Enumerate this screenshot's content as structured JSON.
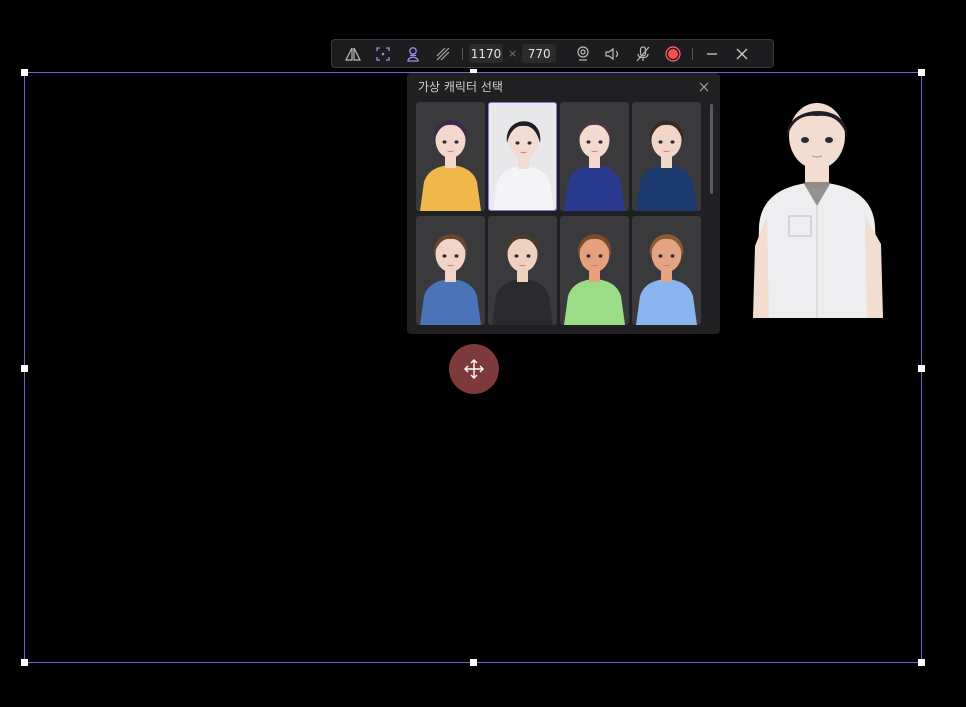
{
  "toolbar": {
    "width_value": "1170",
    "height_value": "770",
    "separator": "×",
    "record_color": "#ff4d4f",
    "icons": [
      "flip-icon",
      "region-icon",
      "virtual-character-icon",
      "hatch-icon",
      "webcam-icon",
      "speaker-icon",
      "microphone-icon",
      "record-icon",
      "minimize-icon",
      "close-icon"
    ]
  },
  "panel": {
    "title": "가상 캐릭터 선택",
    "characters": [
      {
        "id": "char-1",
        "hair": "#3b2a4a",
        "skin": "#f3d7cc",
        "top": "#f0b74a",
        "selected": false
      },
      {
        "id": "char-2",
        "hair": "#1e1e24",
        "skin": "#f2dcd2",
        "top": "#f4f4f6",
        "selected": true
      },
      {
        "id": "char-3",
        "hair": "#4a3644",
        "skin": "#f4d9cf",
        "top": "#2a3a8e",
        "selected": false
      },
      {
        "id": "char-4",
        "hair": "#3a2a24",
        "skin": "#f1d6c8",
        "top": "#1d3a6e",
        "selected": false
      },
      {
        "id": "char-5",
        "hair": "#6a4530",
        "skin": "#f2d4c4",
        "top": "#4a73b8",
        "selected": false
      },
      {
        "id": "char-6",
        "hair": "#4a3a2a",
        "skin": "#efd1bf",
        "top": "#2b2b2f",
        "selected": false
      },
      {
        "id": "char-7",
        "hair": "#7a4a2a",
        "skin": "#e7a07d",
        "top": "#9bdc86",
        "selected": false
      },
      {
        "id": "char-8",
        "hair": "#8a5a34",
        "skin": "#e6a383",
        "top": "#8ab4f0",
        "selected": false
      }
    ]
  },
  "move_button_color": "#7e3a3a",
  "frame_color": "#6f63d9"
}
